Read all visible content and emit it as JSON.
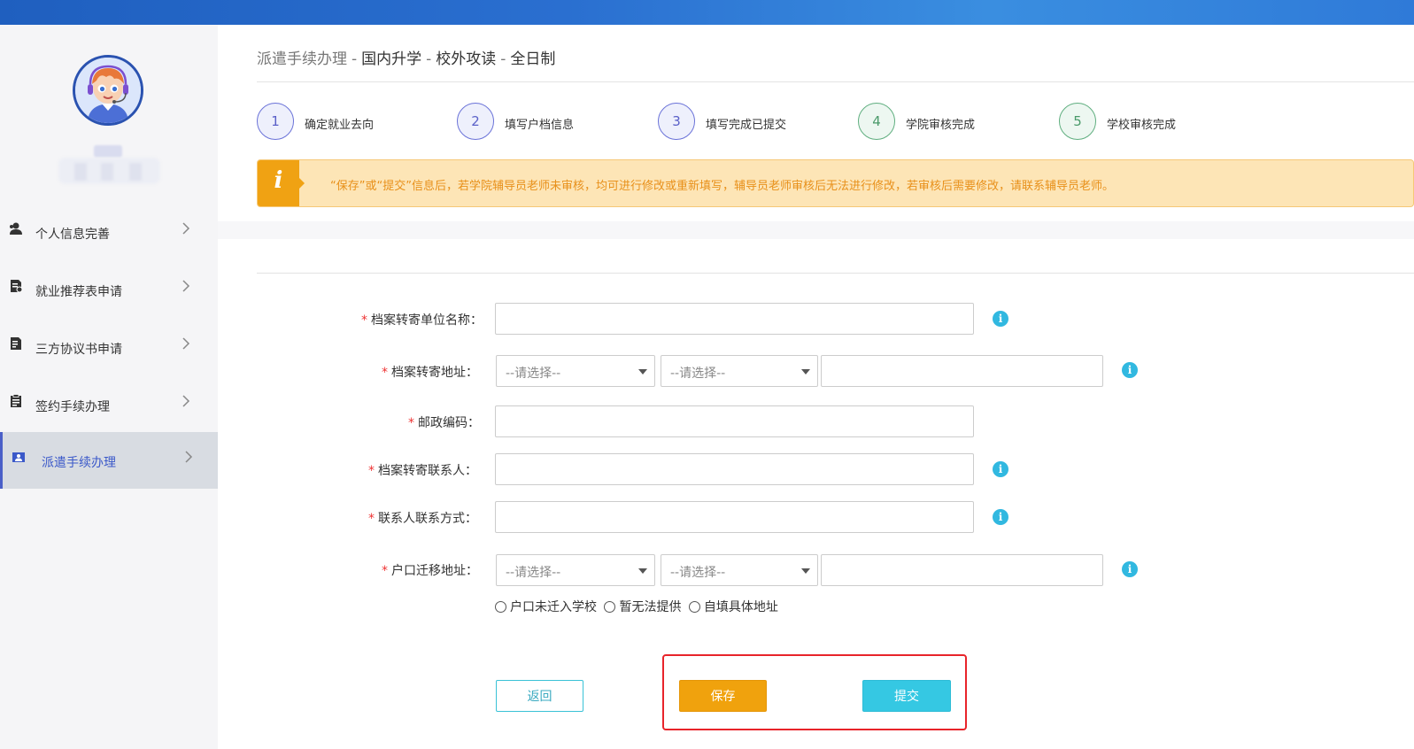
{
  "sidebar": {
    "items": [
      {
        "label": "个人信息完善",
        "icon": "user-icon"
      },
      {
        "label": "就业推荐表申请",
        "icon": "document-icon"
      },
      {
        "label": "三方协议书申请",
        "icon": "agreement-icon"
      },
      {
        "label": "签约手续办理",
        "icon": "clipboard-icon"
      },
      {
        "label": "派遣手续办理",
        "icon": "id-card-icon",
        "active": true
      }
    ]
  },
  "breadcrumb": {
    "root": "派遣手续办理",
    "sep": "-",
    "level1": "国内升学",
    "level2": "校外攻读",
    "level3": "全日制"
  },
  "steps": [
    {
      "number": "1",
      "label": "确定就业去向",
      "state": "current"
    },
    {
      "number": "2",
      "label": "填写户档信息",
      "state": "current"
    },
    {
      "number": "3",
      "label": "填写完成已提交",
      "state": "current"
    },
    {
      "number": "4",
      "label": "学院审核完成",
      "state": "pending"
    },
    {
      "number": "5",
      "label": "学校审核完成",
      "state": "pending"
    }
  ],
  "notice": {
    "icon_text": "i",
    "text": "“保存”或“提交”信息后，若学院辅导员老师未审核，均可进行修改或重新填写，辅导员老师审核后无法进行修改，若审核后需要修改，请联系辅导员老师。"
  },
  "form": {
    "required_mark": "*",
    "fields": {
      "archive_unit": {
        "label": "档案转寄单位名称：",
        "value": ""
      },
      "archive_address": {
        "label": "档案转寄地址：",
        "select1": "--请选择--",
        "select2": "--请选择--",
        "detail": ""
      },
      "postcode": {
        "label": "邮政编码：",
        "value": ""
      },
      "archive_contact": {
        "label": "档案转寄联系人：",
        "value": ""
      },
      "contact_phone": {
        "label": "联系人联系方式：",
        "value": ""
      },
      "hukou_address": {
        "label": "户口迁移地址：",
        "select1": "--请选择--",
        "select2": "--请选择--",
        "detail": ""
      }
    },
    "info_icon_text": "i",
    "hukou_options": [
      "户口未迁入学校",
      "暂无法提供",
      "自填具体地址"
    ]
  },
  "buttons": {
    "back": "返回",
    "save": "保存",
    "submit": "提交"
  },
  "colors": {
    "primary": "#3b59c9",
    "accent_orange": "#f0a20d",
    "accent_cyan": "#35c8e3",
    "notice_bg": "#fde5b6",
    "highlight_red": "#e8242a"
  }
}
